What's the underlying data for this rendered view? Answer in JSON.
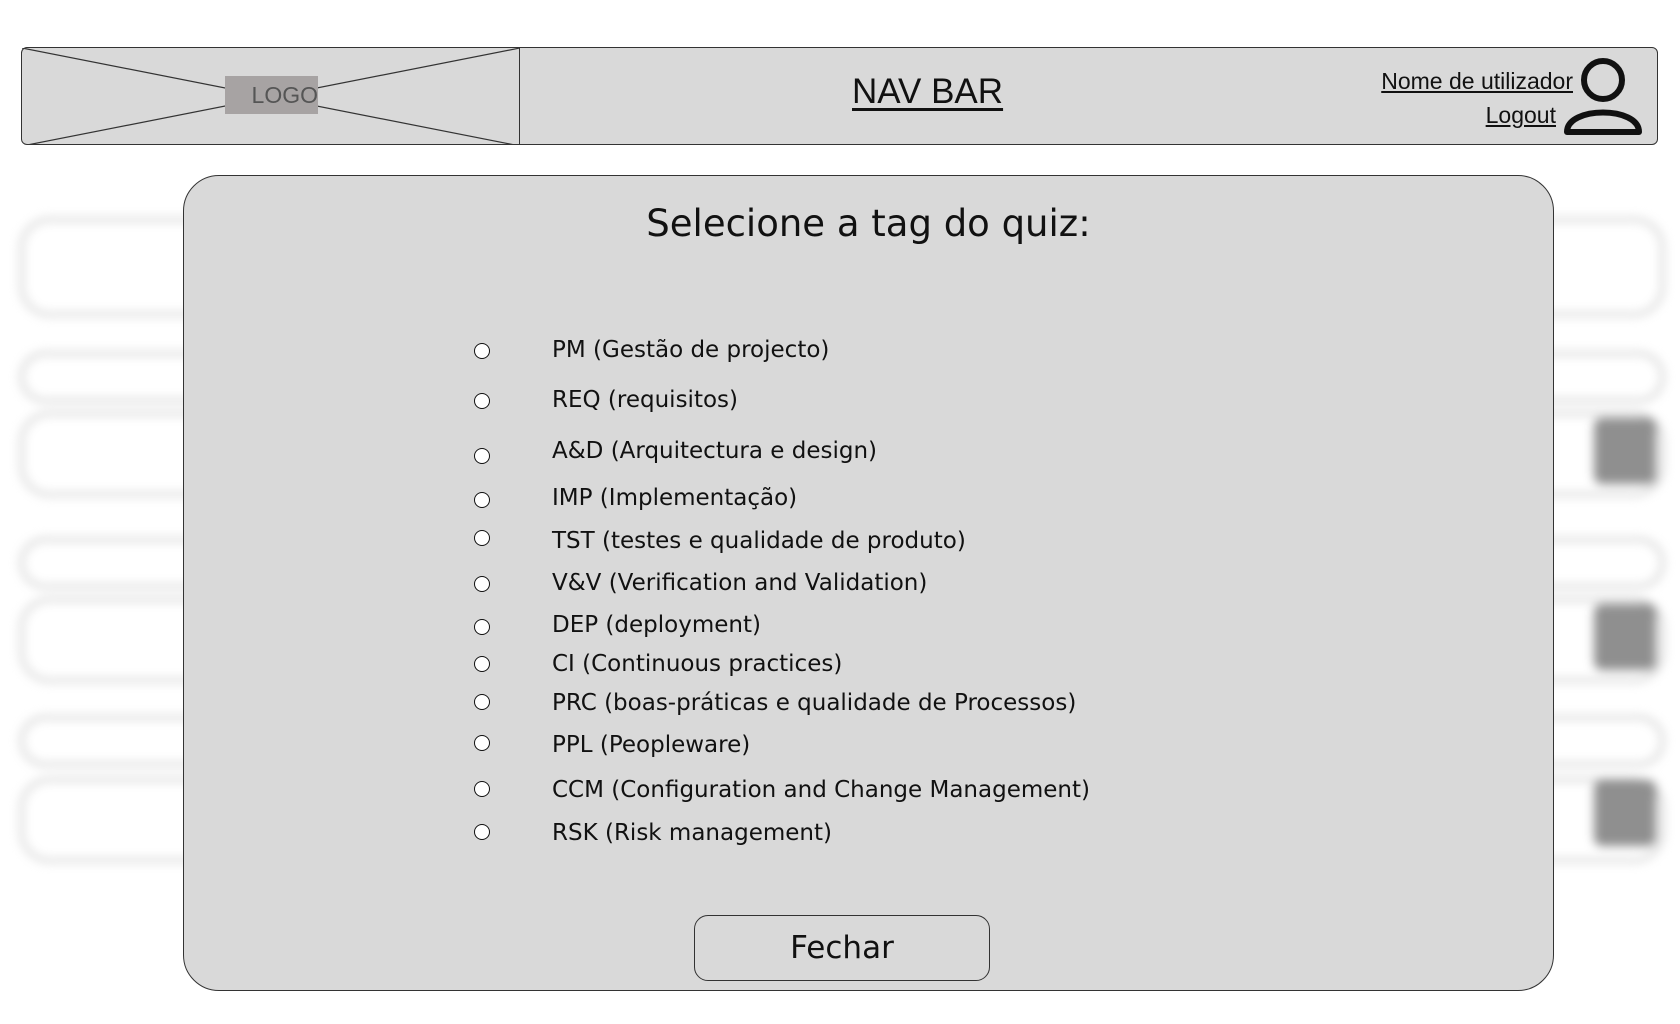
{
  "navbar": {
    "logo_label": "LOGO",
    "title": "NAV BAR",
    "user_name": "Nome de utilizador",
    "logout_label": "Logout",
    "avatar_icon": "user-icon"
  },
  "modal": {
    "title": "Selecione a tag do quiz:",
    "options": [
      {
        "label": "PM (Gestão de projecto)"
      },
      {
        "label": "REQ (requisitos)"
      },
      {
        "label": "A&D (Arquitectura e design)"
      },
      {
        "label": "IMP (Implementação)"
      },
      {
        "label": "TST (testes e qualidade de produto)"
      },
      {
        "label": "V&V (Verification and Validation)"
      },
      {
        "label": "DEP (deployment)"
      },
      {
        "label": "CI (Continuous practices)"
      },
      {
        "label": "PRC (boas-práticas e qualidade de Processos)"
      },
      {
        "label": "PPL (Peopleware)"
      },
      {
        "label": "CCM (Configuration and Change Management)"
      },
      {
        "label": "RSK (Risk management)"
      }
    ],
    "close_label": "Fechar"
  },
  "colors": {
    "panel": "#d9d9d9",
    "border": "#333333",
    "logo_fill": "#a7a3a3"
  }
}
